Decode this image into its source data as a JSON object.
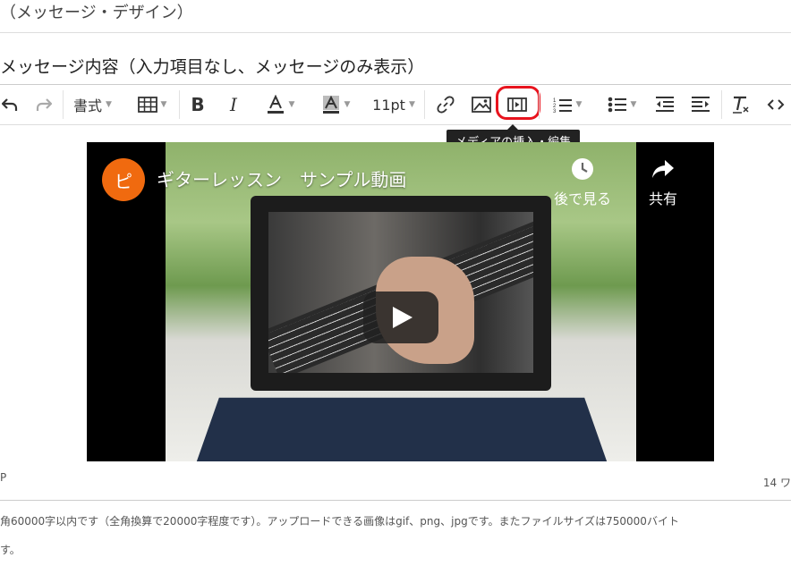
{
  "page": {
    "section_title": "（メッセージ・デザイン）",
    "field_label": "メッセージ内容（入力項目なし、メッセージのみ表示）"
  },
  "toolbar": {
    "format_label": "書式",
    "font_size_label": "11pt",
    "tooltip": "メディアの挿入・編集",
    "highlight_color": "#e8141e"
  },
  "video": {
    "channel_initial": "ピ",
    "channel_color": "#f06a0f",
    "title": "ギターレッスン　サンプル動画",
    "watch_later_label": "後で見る",
    "share_label": "共有"
  },
  "status": {
    "path": "P",
    "word_count": "14 ワ"
  },
  "note": {
    "line1": "角60000字以内です（全角換算で20000字程度です）。アップロードできる画像はgif、png、jpgです。またファイルサイズは750000バイト",
    "line2": "す。"
  }
}
